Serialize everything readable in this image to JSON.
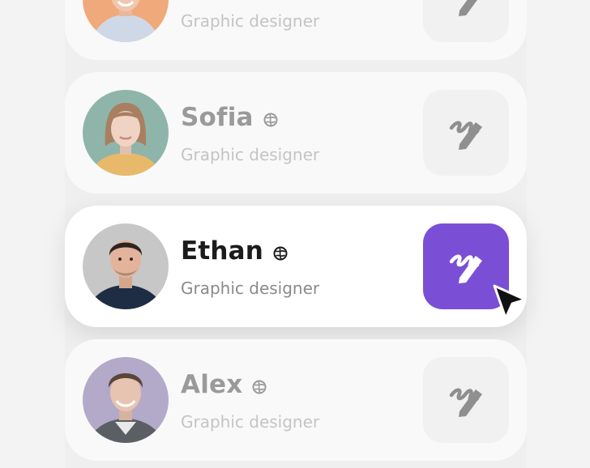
{
  "people": [
    {
      "name": "",
      "role": "Graphic designer",
      "state": "dimmed"
    },
    {
      "name": "Sofia",
      "role": "Graphic designer",
      "state": "dimmed"
    },
    {
      "name": "Ethan",
      "role": "Graphic designer",
      "state": "active"
    },
    {
      "name": "Alex",
      "role": "Graphic designer",
      "state": "dimmed"
    }
  ],
  "icons": {
    "badge": "verified-globe-icon",
    "edit": "pencil-edit-icon",
    "cursor": "mouse-pointer-icon"
  },
  "colors": {
    "accent": "#7a4fd6",
    "active_name": "#1b1b1b",
    "dim_name": "#9a9a9a"
  }
}
